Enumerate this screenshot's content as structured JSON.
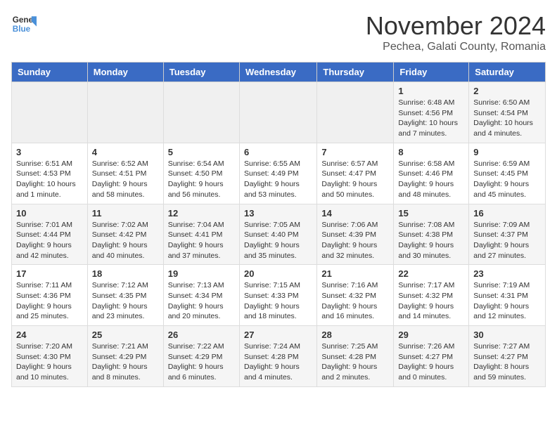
{
  "logo": {
    "line1": "General",
    "line2": "Blue"
  },
  "title": "November 2024",
  "subtitle": "Pechea, Galati County, Romania",
  "weekdays": [
    "Sunday",
    "Monday",
    "Tuesday",
    "Wednesday",
    "Thursday",
    "Friday",
    "Saturday"
  ],
  "weeks": [
    [
      {
        "day": "",
        "info": ""
      },
      {
        "day": "",
        "info": ""
      },
      {
        "day": "",
        "info": ""
      },
      {
        "day": "",
        "info": ""
      },
      {
        "day": "",
        "info": ""
      },
      {
        "day": "1",
        "info": "Sunrise: 6:48 AM\nSunset: 4:56 PM\nDaylight: 10 hours and 7 minutes."
      },
      {
        "day": "2",
        "info": "Sunrise: 6:50 AM\nSunset: 4:54 PM\nDaylight: 10 hours and 4 minutes."
      }
    ],
    [
      {
        "day": "3",
        "info": "Sunrise: 6:51 AM\nSunset: 4:53 PM\nDaylight: 10 hours and 1 minute."
      },
      {
        "day": "4",
        "info": "Sunrise: 6:52 AM\nSunset: 4:51 PM\nDaylight: 9 hours and 58 minutes."
      },
      {
        "day": "5",
        "info": "Sunrise: 6:54 AM\nSunset: 4:50 PM\nDaylight: 9 hours and 56 minutes."
      },
      {
        "day": "6",
        "info": "Sunrise: 6:55 AM\nSunset: 4:49 PM\nDaylight: 9 hours and 53 minutes."
      },
      {
        "day": "7",
        "info": "Sunrise: 6:57 AM\nSunset: 4:47 PM\nDaylight: 9 hours and 50 minutes."
      },
      {
        "day": "8",
        "info": "Sunrise: 6:58 AM\nSunset: 4:46 PM\nDaylight: 9 hours and 48 minutes."
      },
      {
        "day": "9",
        "info": "Sunrise: 6:59 AM\nSunset: 4:45 PM\nDaylight: 9 hours and 45 minutes."
      }
    ],
    [
      {
        "day": "10",
        "info": "Sunrise: 7:01 AM\nSunset: 4:44 PM\nDaylight: 9 hours and 42 minutes."
      },
      {
        "day": "11",
        "info": "Sunrise: 7:02 AM\nSunset: 4:42 PM\nDaylight: 9 hours and 40 minutes."
      },
      {
        "day": "12",
        "info": "Sunrise: 7:04 AM\nSunset: 4:41 PM\nDaylight: 9 hours and 37 minutes."
      },
      {
        "day": "13",
        "info": "Sunrise: 7:05 AM\nSunset: 4:40 PM\nDaylight: 9 hours and 35 minutes."
      },
      {
        "day": "14",
        "info": "Sunrise: 7:06 AM\nSunset: 4:39 PM\nDaylight: 9 hours and 32 minutes."
      },
      {
        "day": "15",
        "info": "Sunrise: 7:08 AM\nSunset: 4:38 PM\nDaylight: 9 hours and 30 minutes."
      },
      {
        "day": "16",
        "info": "Sunrise: 7:09 AM\nSunset: 4:37 PM\nDaylight: 9 hours and 27 minutes."
      }
    ],
    [
      {
        "day": "17",
        "info": "Sunrise: 7:11 AM\nSunset: 4:36 PM\nDaylight: 9 hours and 25 minutes."
      },
      {
        "day": "18",
        "info": "Sunrise: 7:12 AM\nSunset: 4:35 PM\nDaylight: 9 hours and 23 minutes."
      },
      {
        "day": "19",
        "info": "Sunrise: 7:13 AM\nSunset: 4:34 PM\nDaylight: 9 hours and 20 minutes."
      },
      {
        "day": "20",
        "info": "Sunrise: 7:15 AM\nSunset: 4:33 PM\nDaylight: 9 hours and 18 minutes."
      },
      {
        "day": "21",
        "info": "Sunrise: 7:16 AM\nSunset: 4:32 PM\nDaylight: 9 hours and 16 minutes."
      },
      {
        "day": "22",
        "info": "Sunrise: 7:17 AM\nSunset: 4:32 PM\nDaylight: 9 hours and 14 minutes."
      },
      {
        "day": "23",
        "info": "Sunrise: 7:19 AM\nSunset: 4:31 PM\nDaylight: 9 hours and 12 minutes."
      }
    ],
    [
      {
        "day": "24",
        "info": "Sunrise: 7:20 AM\nSunset: 4:30 PM\nDaylight: 9 hours and 10 minutes."
      },
      {
        "day": "25",
        "info": "Sunrise: 7:21 AM\nSunset: 4:29 PM\nDaylight: 9 hours and 8 minutes."
      },
      {
        "day": "26",
        "info": "Sunrise: 7:22 AM\nSunset: 4:29 PM\nDaylight: 9 hours and 6 minutes."
      },
      {
        "day": "27",
        "info": "Sunrise: 7:24 AM\nSunset: 4:28 PM\nDaylight: 9 hours and 4 minutes."
      },
      {
        "day": "28",
        "info": "Sunrise: 7:25 AM\nSunset: 4:28 PM\nDaylight: 9 hours and 2 minutes."
      },
      {
        "day": "29",
        "info": "Sunrise: 7:26 AM\nSunset: 4:27 PM\nDaylight: 9 hours and 0 minutes."
      },
      {
        "day": "30",
        "info": "Sunrise: 7:27 AM\nSunset: 4:27 PM\nDaylight: 8 hours and 59 minutes."
      }
    ]
  ]
}
